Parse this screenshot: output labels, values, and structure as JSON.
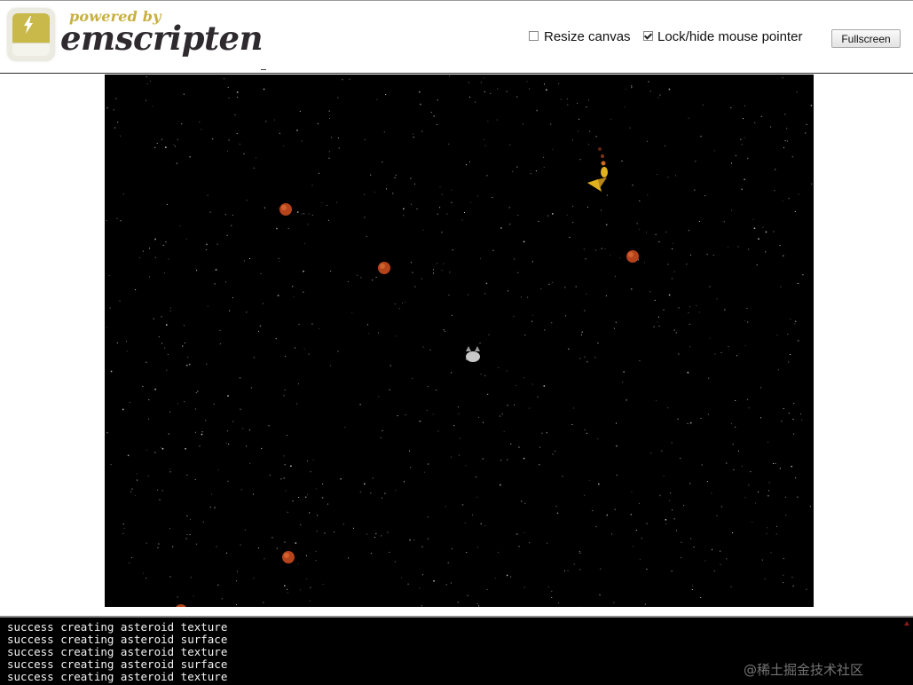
{
  "header": {
    "powered_text": "powered by",
    "brand_text": "emscripten",
    "resize_canvas": {
      "label": "Resize canvas",
      "checked": false
    },
    "lock_pointer": {
      "label": "Lock/hide mouse pointer",
      "checked": true
    },
    "fullscreen_label": "Fullscreen"
  },
  "game": {
    "background": "#000000",
    "asteroid_color": "#b5431c",
    "player_ship_color": "#c8c8c8",
    "enemy_ship_color": "#e2b21e"
  },
  "console": {
    "lines": [
      "success creating asteroid texture",
      "success creating asteroid surface",
      "success creating asteroid texture",
      "success creating asteroid surface",
      "success creating asteroid texture"
    ]
  },
  "watermark": "@稀土掘金技术社区"
}
